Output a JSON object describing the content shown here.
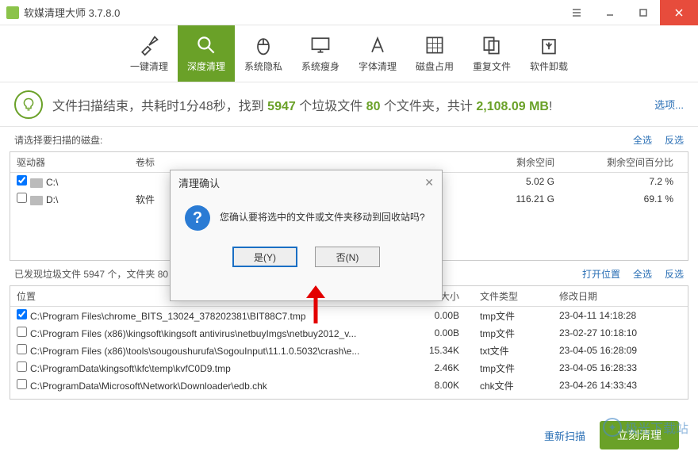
{
  "titlebar": {
    "title": "软媒清理大师 3.7.8.0"
  },
  "nav": [
    {
      "label": "一键清理",
      "icon": "brush-icon"
    },
    {
      "label": "深度清理",
      "icon": "magnifier-icon"
    },
    {
      "label": "系统隐私",
      "icon": "mouse-icon"
    },
    {
      "label": "系统瘦身",
      "icon": "monitor-icon"
    },
    {
      "label": "字体清理",
      "icon": "font-icon"
    },
    {
      "label": "磁盘占用",
      "icon": "grid-icon"
    },
    {
      "label": "重复文件",
      "icon": "duplicate-icon"
    },
    {
      "label": "软件卸载",
      "icon": "recycle-icon"
    }
  ],
  "summary": {
    "prefix": "文件扫描结束，共耗时",
    "time": "1分48秒",
    "mid1": "，找到 ",
    "trash": "5947",
    "mid2": " 个垃圾文件 ",
    "folders": "80",
    "mid3": " 个文件夹，共计 ",
    "size": "2,108.09 MB",
    "suffix": "!",
    "options": "选项..."
  },
  "disk_section": {
    "label": "请选择要扫描的磁盘:",
    "select_all": "全选",
    "invert": "反选",
    "cols": {
      "drive": "驱动器",
      "label": "卷标",
      "free": "剩余空间",
      "pct": "剩余空间百分比"
    },
    "rows": [
      {
        "checked": true,
        "name": "C:\\",
        "label": "",
        "free": "5.02 G",
        "pct": "7.2 %"
      },
      {
        "checked": false,
        "name": "D:\\",
        "label": "软件",
        "free": "116.21 G",
        "pct": "69.1 %"
      }
    ]
  },
  "file_section": {
    "stats": "已发现垃圾文件 5947 个，文件夹 80",
    "open_loc": "打开位置",
    "select_all": "全选",
    "invert": "反选",
    "cols": {
      "path": "位置",
      "size": "大小",
      "type": "文件类型",
      "date": "修改日期"
    },
    "rows": [
      {
        "checked": true,
        "path": "C:\\Program Files\\chrome_BITS_13024_378202381\\BIT88C7.tmp",
        "size": "0.00B",
        "type": "tmp文件",
        "date": "23-04-11   14:18:28"
      },
      {
        "checked": false,
        "path": "C:\\Program Files (x86)\\kingsoft\\kingsoft antivirus\\netbuyImgs\\netbuy2012_v...",
        "size": "0.00B",
        "type": "tmp文件",
        "date": "23-02-27   10:18:10"
      },
      {
        "checked": false,
        "path": "C:\\Program Files (x86)\\tools\\sougoushurufa\\SogouInput\\11.1.0.5032\\crash\\e...",
        "size": "15.34K",
        "type": "txt文件",
        "date": "23-04-05   16:28:09"
      },
      {
        "checked": false,
        "path": "C:\\ProgramData\\kingsoft\\kfc\\temp\\kvfC0D9.tmp",
        "size": "2.46K",
        "type": "tmp文件",
        "date": "23-04-05   16:28:33"
      },
      {
        "checked": false,
        "path": "C:\\ProgramData\\Microsoft\\Network\\Downloader\\edb.chk",
        "size": "8.00K",
        "type": "chk文件",
        "date": "23-04-26   14:33:43"
      }
    ]
  },
  "bottom": {
    "rescan": "重新扫描",
    "clean": "立刻清理"
  },
  "watermark": {
    "text": "极光下载站"
  },
  "dialog": {
    "title": "清理确认",
    "message": "您确认要将选中的文件或文件夹移动到回收站吗?",
    "yes": "是(Y)",
    "no": "否(N)"
  }
}
